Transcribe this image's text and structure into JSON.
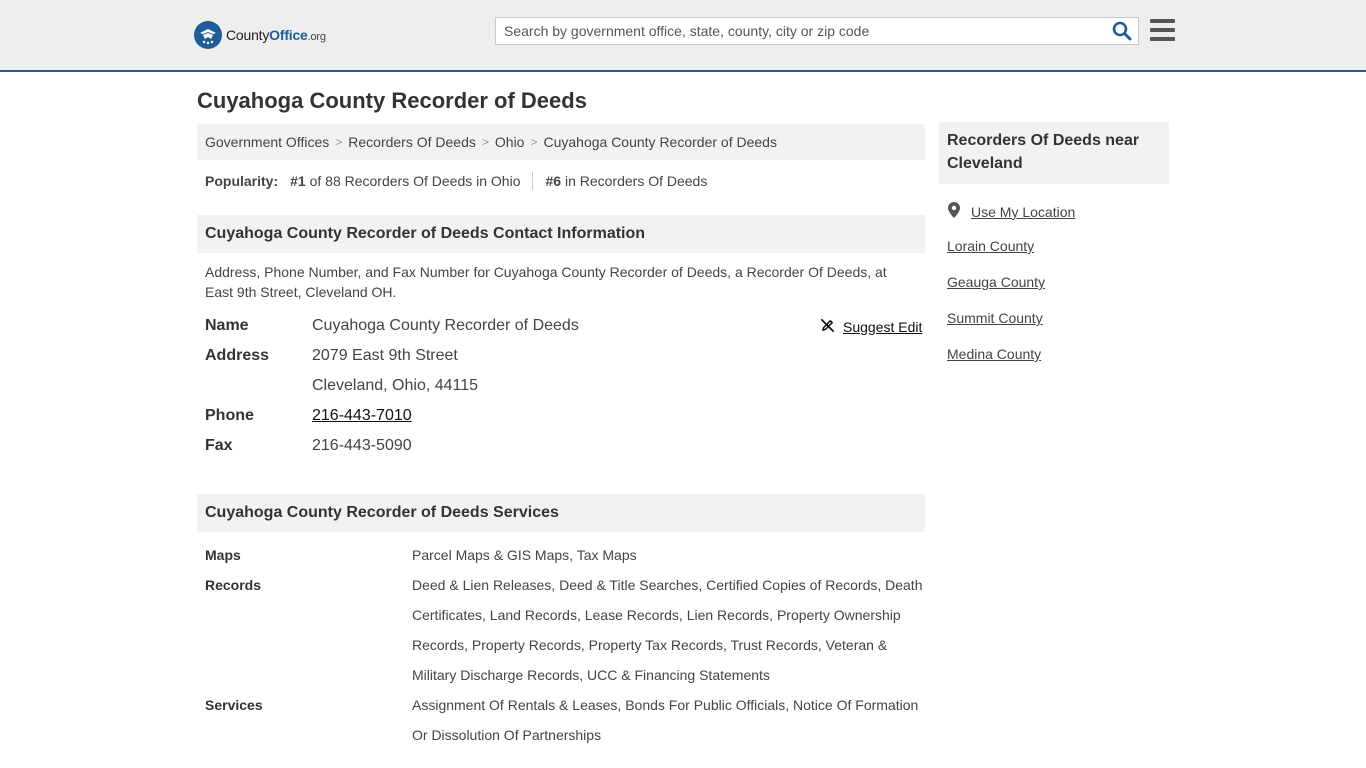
{
  "header": {
    "logo": {
      "brand_a": "County",
      "brand_b": "Office",
      "tld": ".org"
    },
    "search_placeholder": "Search by government office, state, county, city or zip code"
  },
  "page_title": "Cuyahoga County Recorder of Deeds",
  "breadcrumb": [
    "Government Offices",
    "Recorders Of Deeds",
    "Ohio",
    "Cuyahoga County Recorder of Deeds"
  ],
  "popularity": {
    "label": "Popularity:",
    "rank1": "#1",
    "rank1_text": " of 88 Recorders Of Deeds in Ohio",
    "rank2": "#6",
    "rank2_text": " in Recorders Of Deeds"
  },
  "contact": {
    "heading": "Cuyahoga County Recorder of Deeds Contact Information",
    "description": "Address, Phone Number, and Fax Number for Cuyahoga County Recorder of Deeds, a Recorder Of Deeds, at East 9th Street, Cleveland OH.",
    "suggest_edit": "Suggest Edit",
    "name_label": "Name",
    "name": "Cuyahoga County Recorder of Deeds",
    "address_label": "Address",
    "address_line1": "2079 East 9th Street",
    "address_line2": "Cleveland, Ohio, 44115",
    "phone_label": "Phone",
    "phone": "216-443-7010",
    "fax_label": "Fax",
    "fax": "216-443-5090"
  },
  "services": {
    "heading": "Cuyahoga County Recorder of Deeds Services",
    "rows": [
      {
        "label": "Maps",
        "value": "Parcel Maps & GIS Maps, Tax Maps"
      },
      {
        "label": "Records",
        "value": "Deed & Lien Releases, Deed & Title Searches, Certified Copies of Records, Death Certificates, Land Records, Lease Records, Lien Records, Property Ownership Records, Property Records, Property Tax Records, Trust Records, Veteran & Military Discharge Records, UCC & Financing Statements"
      },
      {
        "label": "Services",
        "value": "Assignment Of Rentals & Leases, Bonds For Public Officials, Notice Of Formation Or Dissolution Of Partnerships"
      }
    ]
  },
  "sidebar": {
    "heading": "Recorders Of Deeds near Cleveland",
    "use_location": "Use My Location",
    "links": [
      "Lorain County",
      "Geauga County",
      "Summit County",
      "Medina County"
    ]
  },
  "colors": {
    "brand_blue": "#1f5c99",
    "header_bg": "#eeeeee",
    "panel_bg": "#f2f2f2"
  }
}
